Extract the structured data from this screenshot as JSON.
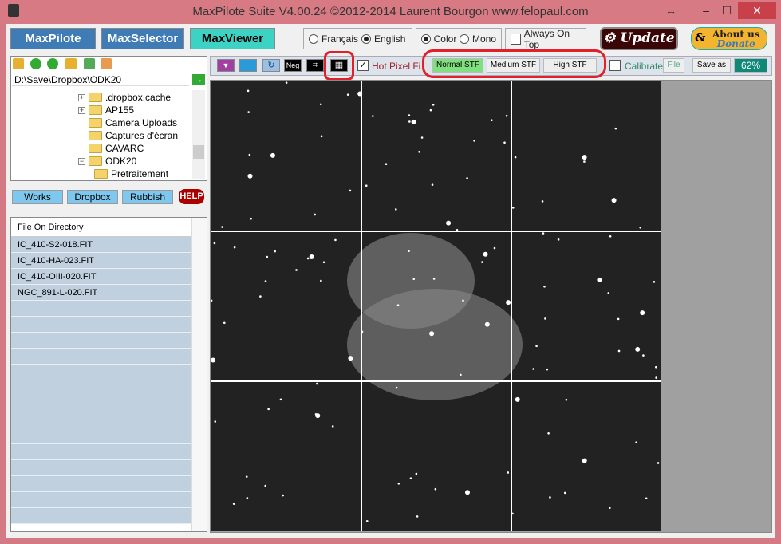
{
  "window": {
    "title": "MaxPilote Suite  V4.00.24  ©2012-2014 Laurent Bourgon  www.felopaul.com",
    "resize": "↔",
    "minimize": "–",
    "maximize": "☐",
    "close": "✕"
  },
  "modules": [
    {
      "label": "MaxPilote"
    },
    {
      "label": "MaxSelector"
    },
    {
      "label": "MaxViewer",
      "active": true
    }
  ],
  "language": {
    "options": [
      "Français",
      "English"
    ],
    "selected": "English"
  },
  "colormode": {
    "options": [
      "Color",
      "Mono"
    ],
    "selected": "Color"
  },
  "always_on_top": {
    "label": "Always On Top",
    "checked": false
  },
  "update_label": "Update",
  "donate": {
    "line1": "About us",
    "line2": "Donate",
    "amp": "&"
  },
  "path": {
    "value": "D:\\Save\\Dropbox\\ODK20",
    "go": "→"
  },
  "tree": [
    {
      "label": ".dropbox.cache",
      "expander": "+"
    },
    {
      "label": "AP155",
      "expander": "+"
    },
    {
      "label": "Camera Uploads",
      "expander": ""
    },
    {
      "label": "Captures d'écran",
      "expander": ""
    },
    {
      "label": "CAVARC",
      "expander": ""
    },
    {
      "label": "ODK20",
      "expander": "−"
    },
    {
      "label": "Pretraitement",
      "expander": "",
      "child": true
    }
  ],
  "tabs": [
    "Works",
    "Dropbox",
    "Rubbish"
  ],
  "help_label": "HELP",
  "files": {
    "header": "File On Directory",
    "items": [
      "IC_410-S2-018.FIT",
      "IC_410-HA-023.FIT",
      "IC_410-OIII-020.FIT",
      "NGC_891-L-020.FIT"
    ]
  },
  "viewer": {
    "neg_label": "Neg",
    "hot_pixel": {
      "label": "Hot Pixel Filter",
      "checked": true
    },
    "stf": [
      {
        "label": "Normal STF",
        "active": true
      },
      {
        "label": "Medium STF"
      },
      {
        "label": "High STF"
      }
    ],
    "calibrate": {
      "label": "Calibrate",
      "checked": false
    },
    "file_label": "File",
    "save_as_label": "Save as",
    "zoom": "62%"
  }
}
